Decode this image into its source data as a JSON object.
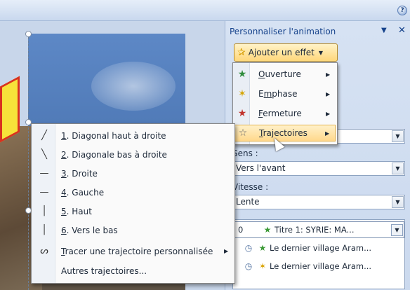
{
  "task_pane": {
    "title": "Personnaliser l'animation",
    "add_effect": "Ajouter un effet",
    "sens_label": "Sens :",
    "sens_value": "Vers l'avant",
    "vitesse_label": "Vitesse :",
    "vitesse_value": "Lente",
    "list_rows": [
      {
        "num": "0",
        "text": "Titre 1: SYRIE:  MA..."
      },
      {
        "text": "Le dernier village Aram..."
      },
      {
        "text": "Le dernier village Aram..."
      }
    ]
  },
  "effect_menu": {
    "items": [
      {
        "label": "Ouverture",
        "key": "O",
        "rest": "uverture"
      },
      {
        "label": "Emphase",
        "key": "m",
        "pre": "E",
        "rest": "phase"
      },
      {
        "label": "Fermeture",
        "key": "F",
        "rest": "ermeture"
      },
      {
        "label": "Trajectoires",
        "key": "T",
        "rest": "rajectoires"
      }
    ]
  },
  "trajectory_menu": {
    "items": [
      {
        "num": "1",
        "text": ". Diagonal haut à droite"
      },
      {
        "num": "2",
        "text": ". Diagonale bas à droite"
      },
      {
        "num": "3",
        "text": ". Droite"
      },
      {
        "num": "4",
        "text": ". Gauche"
      },
      {
        "num": "5",
        "text": ". Haut"
      },
      {
        "num": "6",
        "text": ". Vers le bas"
      },
      {
        "key": "T",
        "text": "racer une trajectoire personnalisée"
      },
      {
        "text": "Autres trajectoires..."
      }
    ]
  },
  "colors": {
    "pane_title": "#15428b",
    "menu_highlight": "#ffd88c"
  }
}
